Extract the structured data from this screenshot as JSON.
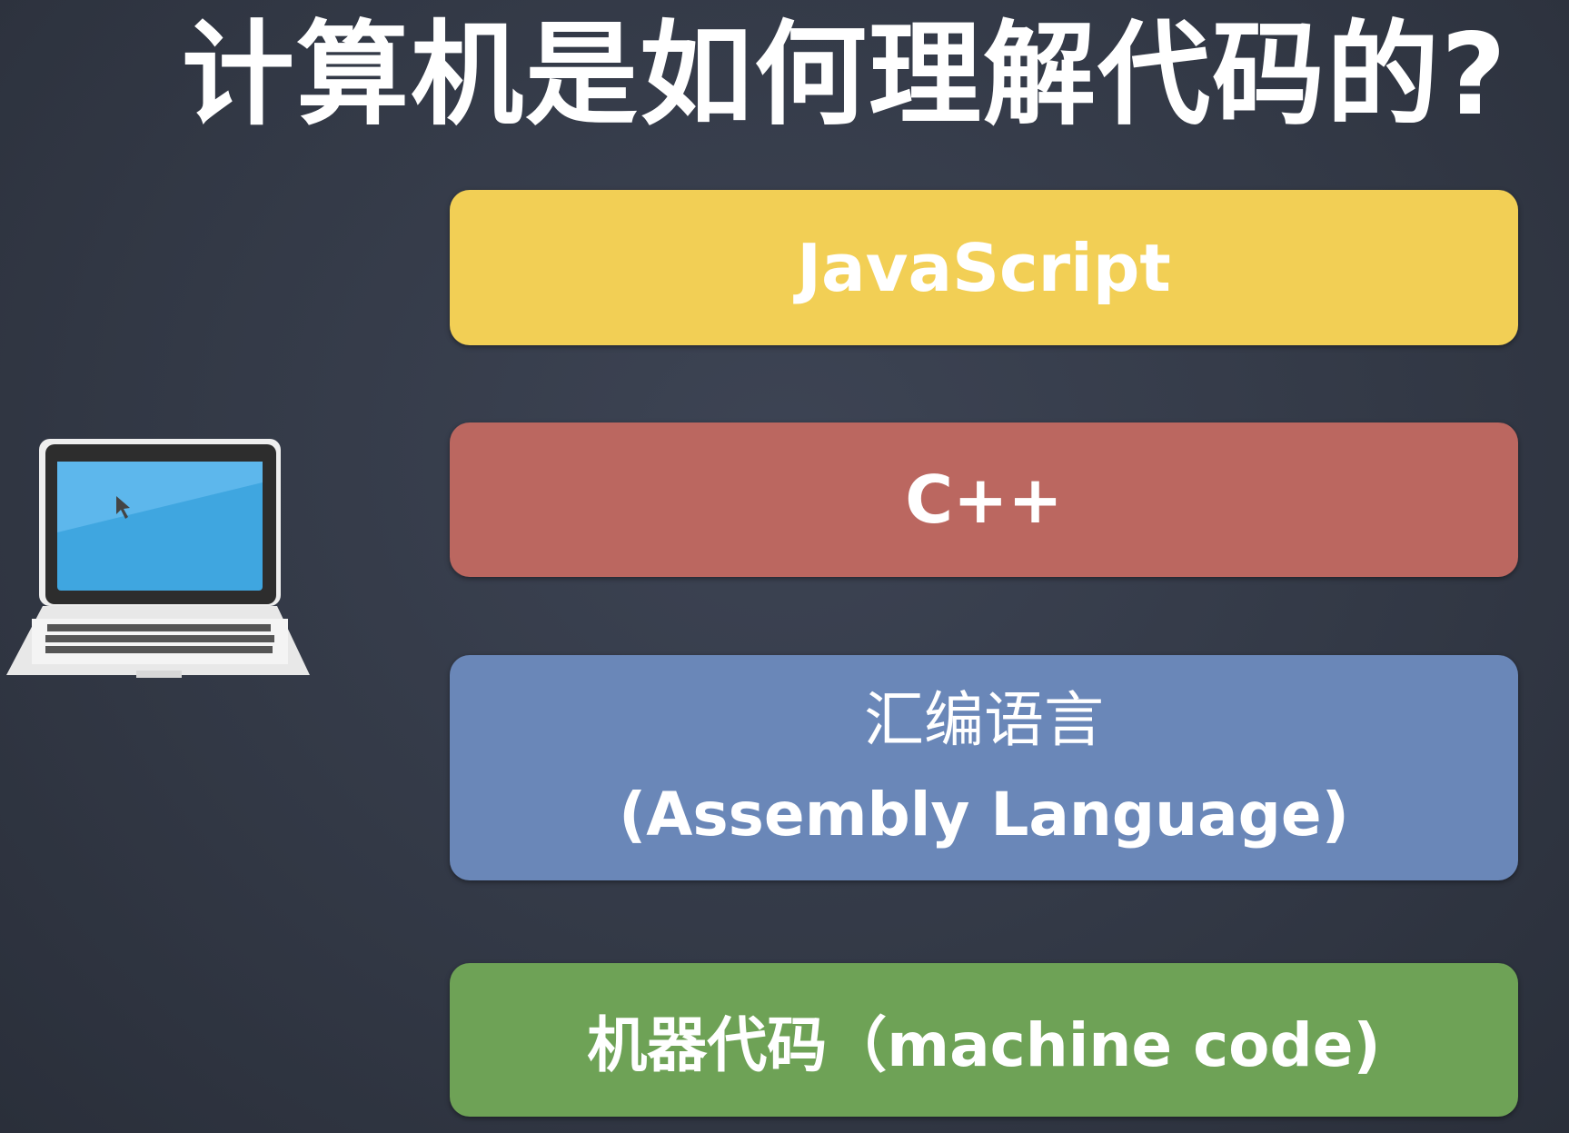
{
  "title": "计算机是如何理解代码的?",
  "layers": [
    {
      "label": "JavaScript",
      "color": "#f2cf55"
    },
    {
      "label": "C++",
      "color": "#bb6760"
    },
    {
      "label_zh": "汇编语言",
      "label_en": "(Assembly Language)",
      "color": "#6a87b8"
    },
    {
      "label": "机器代码（machine code)",
      "color": "#6ea256"
    }
  ],
  "illustration": {
    "icon": "laptop-icon"
  }
}
